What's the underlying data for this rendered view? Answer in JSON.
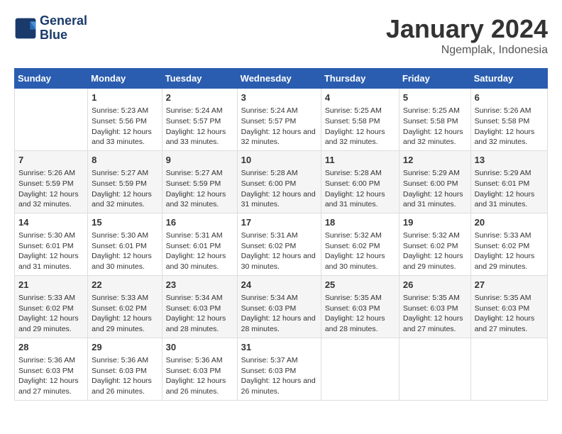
{
  "header": {
    "logo_line1": "General",
    "logo_line2": "Blue",
    "month_title": "January 2024",
    "location": "Ngemplak, Indonesia"
  },
  "days_of_week": [
    "Sunday",
    "Monday",
    "Tuesday",
    "Wednesday",
    "Thursday",
    "Friday",
    "Saturday"
  ],
  "weeks": [
    [
      {
        "day": "",
        "sunrise": "",
        "sunset": "",
        "daylight": ""
      },
      {
        "day": "1",
        "sunrise": "Sunrise: 5:23 AM",
        "sunset": "Sunset: 5:56 PM",
        "daylight": "Daylight: 12 hours and 33 minutes."
      },
      {
        "day": "2",
        "sunrise": "Sunrise: 5:24 AM",
        "sunset": "Sunset: 5:57 PM",
        "daylight": "Daylight: 12 hours and 33 minutes."
      },
      {
        "day": "3",
        "sunrise": "Sunrise: 5:24 AM",
        "sunset": "Sunset: 5:57 PM",
        "daylight": "Daylight: 12 hours and 32 minutes."
      },
      {
        "day": "4",
        "sunrise": "Sunrise: 5:25 AM",
        "sunset": "Sunset: 5:58 PM",
        "daylight": "Daylight: 12 hours and 32 minutes."
      },
      {
        "day": "5",
        "sunrise": "Sunrise: 5:25 AM",
        "sunset": "Sunset: 5:58 PM",
        "daylight": "Daylight: 12 hours and 32 minutes."
      },
      {
        "day": "6",
        "sunrise": "Sunrise: 5:26 AM",
        "sunset": "Sunset: 5:58 PM",
        "daylight": "Daylight: 12 hours and 32 minutes."
      }
    ],
    [
      {
        "day": "7",
        "sunrise": "Sunrise: 5:26 AM",
        "sunset": "Sunset: 5:59 PM",
        "daylight": "Daylight: 12 hours and 32 minutes."
      },
      {
        "day": "8",
        "sunrise": "Sunrise: 5:27 AM",
        "sunset": "Sunset: 5:59 PM",
        "daylight": "Daylight: 12 hours and 32 minutes."
      },
      {
        "day": "9",
        "sunrise": "Sunrise: 5:27 AM",
        "sunset": "Sunset: 5:59 PM",
        "daylight": "Daylight: 12 hours and 32 minutes."
      },
      {
        "day": "10",
        "sunrise": "Sunrise: 5:28 AM",
        "sunset": "Sunset: 6:00 PM",
        "daylight": "Daylight: 12 hours and 31 minutes."
      },
      {
        "day": "11",
        "sunrise": "Sunrise: 5:28 AM",
        "sunset": "Sunset: 6:00 PM",
        "daylight": "Daylight: 12 hours and 31 minutes."
      },
      {
        "day": "12",
        "sunrise": "Sunrise: 5:29 AM",
        "sunset": "Sunset: 6:00 PM",
        "daylight": "Daylight: 12 hours and 31 minutes."
      },
      {
        "day": "13",
        "sunrise": "Sunrise: 5:29 AM",
        "sunset": "Sunset: 6:01 PM",
        "daylight": "Daylight: 12 hours and 31 minutes."
      }
    ],
    [
      {
        "day": "14",
        "sunrise": "Sunrise: 5:30 AM",
        "sunset": "Sunset: 6:01 PM",
        "daylight": "Daylight: 12 hours and 31 minutes."
      },
      {
        "day": "15",
        "sunrise": "Sunrise: 5:30 AM",
        "sunset": "Sunset: 6:01 PM",
        "daylight": "Daylight: 12 hours and 30 minutes."
      },
      {
        "day": "16",
        "sunrise": "Sunrise: 5:31 AM",
        "sunset": "Sunset: 6:01 PM",
        "daylight": "Daylight: 12 hours and 30 minutes."
      },
      {
        "day": "17",
        "sunrise": "Sunrise: 5:31 AM",
        "sunset": "Sunset: 6:02 PM",
        "daylight": "Daylight: 12 hours and 30 minutes."
      },
      {
        "day": "18",
        "sunrise": "Sunrise: 5:32 AM",
        "sunset": "Sunset: 6:02 PM",
        "daylight": "Daylight: 12 hours and 30 minutes."
      },
      {
        "day": "19",
        "sunrise": "Sunrise: 5:32 AM",
        "sunset": "Sunset: 6:02 PM",
        "daylight": "Daylight: 12 hours and 29 minutes."
      },
      {
        "day": "20",
        "sunrise": "Sunrise: 5:33 AM",
        "sunset": "Sunset: 6:02 PM",
        "daylight": "Daylight: 12 hours and 29 minutes."
      }
    ],
    [
      {
        "day": "21",
        "sunrise": "Sunrise: 5:33 AM",
        "sunset": "Sunset: 6:02 PM",
        "daylight": "Daylight: 12 hours and 29 minutes."
      },
      {
        "day": "22",
        "sunrise": "Sunrise: 5:33 AM",
        "sunset": "Sunset: 6:02 PM",
        "daylight": "Daylight: 12 hours and 29 minutes."
      },
      {
        "day": "23",
        "sunrise": "Sunrise: 5:34 AM",
        "sunset": "Sunset: 6:03 PM",
        "daylight": "Daylight: 12 hours and 28 minutes."
      },
      {
        "day": "24",
        "sunrise": "Sunrise: 5:34 AM",
        "sunset": "Sunset: 6:03 PM",
        "daylight": "Daylight: 12 hours and 28 minutes."
      },
      {
        "day": "25",
        "sunrise": "Sunrise: 5:35 AM",
        "sunset": "Sunset: 6:03 PM",
        "daylight": "Daylight: 12 hours and 28 minutes."
      },
      {
        "day": "26",
        "sunrise": "Sunrise: 5:35 AM",
        "sunset": "Sunset: 6:03 PM",
        "daylight": "Daylight: 12 hours and 27 minutes."
      },
      {
        "day": "27",
        "sunrise": "Sunrise: 5:35 AM",
        "sunset": "Sunset: 6:03 PM",
        "daylight": "Daylight: 12 hours and 27 minutes."
      }
    ],
    [
      {
        "day": "28",
        "sunrise": "Sunrise: 5:36 AM",
        "sunset": "Sunset: 6:03 PM",
        "daylight": "Daylight: 12 hours and 27 minutes."
      },
      {
        "day": "29",
        "sunrise": "Sunrise: 5:36 AM",
        "sunset": "Sunset: 6:03 PM",
        "daylight": "Daylight: 12 hours and 26 minutes."
      },
      {
        "day": "30",
        "sunrise": "Sunrise: 5:36 AM",
        "sunset": "Sunset: 6:03 PM",
        "daylight": "Daylight: 12 hours and 26 minutes."
      },
      {
        "day": "31",
        "sunrise": "Sunrise: 5:37 AM",
        "sunset": "Sunset: 6:03 PM",
        "daylight": "Daylight: 12 hours and 26 minutes."
      },
      {
        "day": "",
        "sunrise": "",
        "sunset": "",
        "daylight": ""
      },
      {
        "day": "",
        "sunrise": "",
        "sunset": "",
        "daylight": ""
      },
      {
        "day": "",
        "sunrise": "",
        "sunset": "",
        "daylight": ""
      }
    ]
  ]
}
